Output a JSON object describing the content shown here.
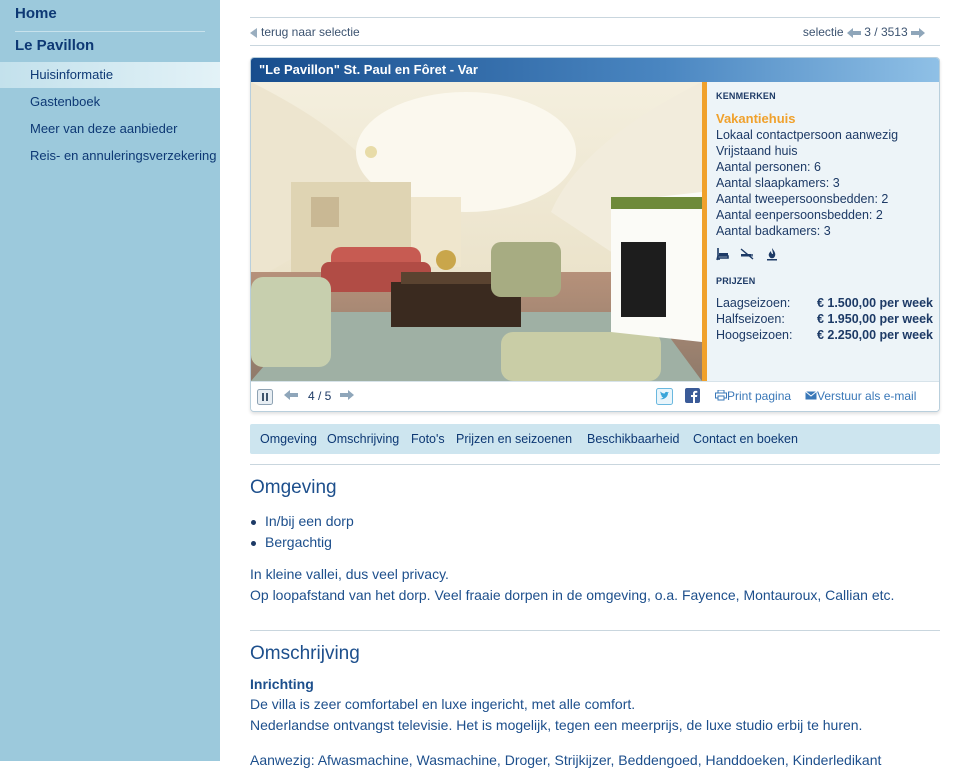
{
  "sidebar": {
    "home": "Home",
    "section": "Le Pavillon",
    "items": [
      {
        "label": "Huisinformatie"
      },
      {
        "label": "Gastenboek"
      },
      {
        "label": "Meer van deze aanbieder"
      },
      {
        "label": "Reis- en annuleringsverzekering"
      }
    ]
  },
  "topbar": {
    "back_label": "terug naar selectie",
    "selection_label": "selectie",
    "selection_counter": "3 / 3513"
  },
  "card": {
    "title": "\"Le Pavillon\" St. Paul en Fôret - Var",
    "features_heading": "KENMERKEN",
    "type": "Vakantiehuis",
    "features": [
      "Lokaal contactpersoon aanwezig",
      "Vrijstaand huis",
      "Aantal personen: 6",
      "Aantal slaapkamers: 3",
      "Aantal tweepersoonsbedden: 2",
      "Aantal eenpersoonsbedden: 2",
      "Aantal badkamers: 3"
    ],
    "feature_icons": [
      "bath-icon",
      "no-smoking-icon",
      "fireplace-icon"
    ],
    "prices_heading": "PRIJZEN",
    "prices": [
      {
        "season": "Laagseizoen:",
        "price": "€ 1.500,00 per week"
      },
      {
        "season": "Halfseizoen:",
        "price": "€ 1.950,00 per week"
      },
      {
        "season": "Hoogseizoen:",
        "price": "€ 2.250,00 per week"
      }
    ],
    "photo_counter": "4 / 5",
    "print_label": "Print pagina",
    "email_label": "Verstuur als e-mail"
  },
  "tabs": [
    "Omgeving",
    "Omschrijving",
    "Foto's",
    "Prijzen en seizoenen",
    "Beschikbaarheid",
    "Contact en boeken"
  ],
  "omgeving": {
    "heading": "Omgeving",
    "bullets": [
      "In/bij een dorp",
      "Bergachtig"
    ],
    "lines": [
      "In kleine vallei, dus veel privacy.",
      "Op loopafstand van het dorp. Veel fraaie dorpen in de omgeving, o.a. Fayence, Montauroux, Callian etc."
    ]
  },
  "omschrijving": {
    "heading": "Omschrijving",
    "subheading": "Inrichting",
    "lines": [
      "De villa is zeer comfortabel en luxe ingericht, met alle comfort.",
      "Nederlandse ontvangst televisie. Het is mogelijk, tegen een meerprijs, de luxe studio erbij te huren."
    ],
    "cut_line": "Aanwezig: Afwasmachine, Wasmachine, Droger, Strijkijzer, Beddengoed, Handdoeken, Kinderledikant"
  },
  "colors": {
    "sidebar_bg": "#9cc9dc",
    "accent_orange": "#f0a12c",
    "title_blue": "#174d8d",
    "tab_bg": "#cde5ef"
  }
}
